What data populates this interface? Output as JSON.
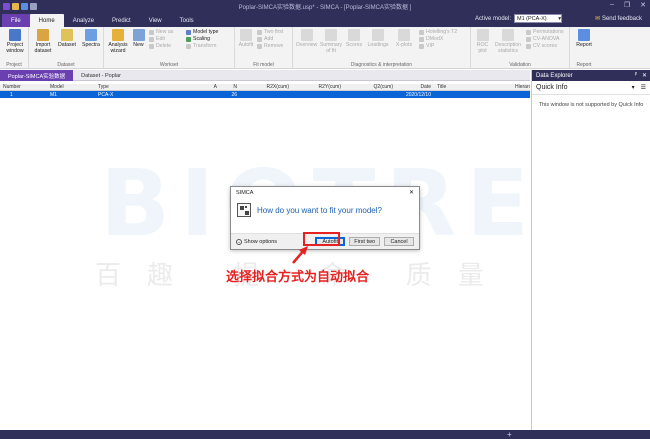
{
  "window": {
    "title": "Poplar-SIMCA实验数据.usp* - SIMCA - [Poplar-SIMCA实验数据 ]",
    "controls": [
      "–",
      "❐",
      "✕"
    ]
  },
  "ribbon_tabs": [
    "File",
    "Home",
    "Analyze",
    "Predict",
    "View",
    "Tools"
  ],
  "active_model": {
    "label": "Active model:",
    "value": "M1 (PCA-X)"
  },
  "send_feedback": "Send feedback",
  "ribbon": {
    "project": {
      "label": "Project",
      "buttons": [
        "Project window"
      ]
    },
    "dataset": {
      "label": "Dataset",
      "buttons": [
        "Import dataset",
        "Dataset",
        "Spectra"
      ]
    },
    "workset_big": [
      "Analysis wizard",
      "New"
    ],
    "workset_small": [
      "New as",
      "Edit",
      "Delete"
    ],
    "workset_small2": [
      "Model type",
      "Scaling",
      "Transform"
    ],
    "workset_label": "Workset",
    "fit": {
      "label": "Fit model",
      "big": [
        "Autofit"
      ],
      "small": [
        "Two first",
        "Add",
        "Remove"
      ]
    },
    "diag": {
      "label": "Diagnostics & interpretation",
      "big": [
        "Overview",
        "Summary of fit",
        "Scores",
        "Loadings",
        "X-plots"
      ],
      "small": [
        "Hotelling's T2",
        "DModX",
        "VIP"
      ]
    },
    "valid": {
      "label": "Validation",
      "big": [
        "ROC plot",
        "Description statistics"
      ],
      "small": [
        "Permutations",
        "CV-ANOVA",
        "CV scores"
      ]
    },
    "report": {
      "label": "Report",
      "buttons": [
        "Report"
      ]
    }
  },
  "doc_tabs": [
    "Poplar-SIMCA实验数据",
    "Dataset - Poplar"
  ],
  "table": {
    "headers": [
      "Number",
      "Model",
      "Type",
      "A",
      "N",
      "R2X(cum)",
      "R2Y(cum)",
      "Q2(cum)",
      "Date",
      "Title",
      "Hierarch"
    ],
    "rows": [
      [
        "1",
        "M1",
        "PCA-X",
        "",
        "26",
        "",
        "",
        "",
        "2020/12/10",
        "",
        ""
      ]
    ]
  },
  "watermark": {
    "main": "BIOTREE",
    "sub": "百趣 提 命 质量"
  },
  "right_panel": {
    "title": "Data Explorer",
    "quick_info": "Quick Info",
    "message": "This window is not supported by Quick Info"
  },
  "dialog": {
    "title": "SIMCA",
    "question": "How do you want to fit your model?",
    "show_options": "Show options",
    "buttons": [
      "Autofit",
      "First two",
      "Cancel"
    ]
  },
  "annotation": "选择拟合方式为自动拟合",
  "colors": {
    "accent": "#6a3fb0",
    "titlebar": "#2f2f5a",
    "selection": "#0a64d6",
    "annotation": "#e52121"
  }
}
